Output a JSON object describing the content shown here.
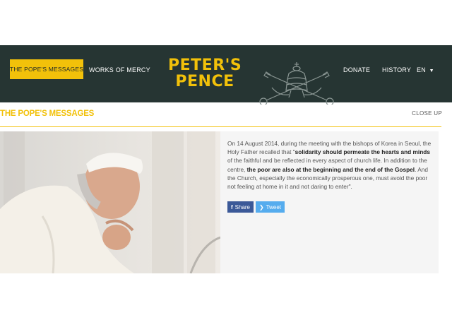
{
  "nav": {
    "active_label": "THE POPE'S MESSAGES",
    "works_label": "WORKS OF MERCY",
    "logo_line1": "PETER'S",
    "logo_line2": "PENCE",
    "donate_label": "DONATE",
    "history_label": "HISTORY",
    "lang_label": "EN"
  },
  "section": {
    "title": "THE POPE'S MESSAGES",
    "close_label": "CLOSE UP"
  },
  "article": {
    "p1": "On 14 August 2014, during the meeting with the bishops of Korea in Seoul, the Holy Father recalled that \"",
    "b1": "solidarity should permeate the hearts and minds",
    "p2": " of the faithful and be reflected in every aspect of church life. In addition to the centre, ",
    "b2": "the poor are also at the beginning and the end of the Gospel",
    "p3": ". And the Church, especially the economically prosperous one, must avoid the poor not feeling at home in it and not daring to enter\".",
    "share_label": "Share",
    "tweet_label": "Tweet"
  },
  "colors": {
    "navbar": "#263533",
    "accent": "#f2c10a",
    "facebook": "#3b5998",
    "twitter": "#55acee"
  },
  "icons": [
    "papal-emblem-icon",
    "caret-down-icon",
    "facebook-icon",
    "twitter-icon"
  ]
}
